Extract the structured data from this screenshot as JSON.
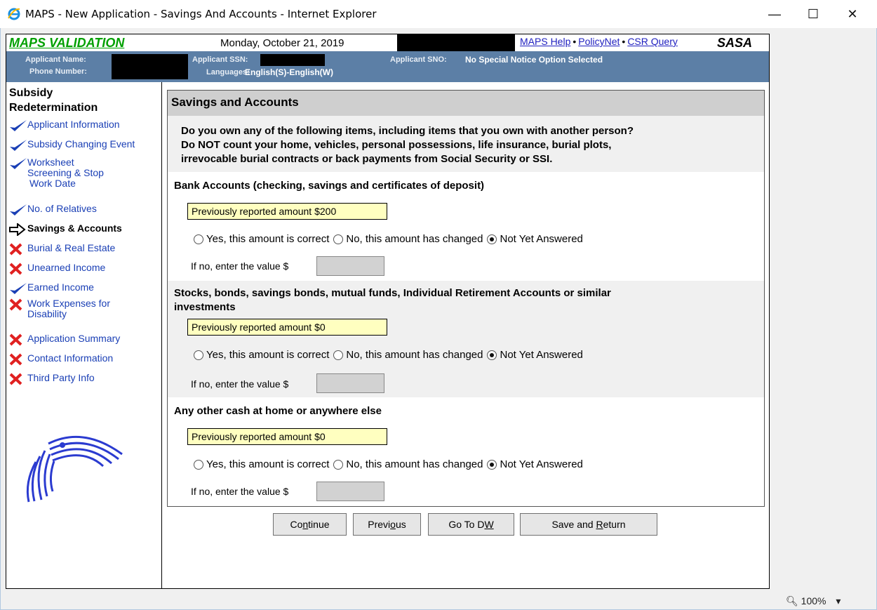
{
  "window": {
    "title": "MAPS - New Application - Savings And Accounts - Internet Explorer",
    "minimize": "—",
    "maximize": "☐",
    "close": "✕"
  },
  "topbar": {
    "maps_validation": "MAPS VALIDATION",
    "date": "Monday, October 21, 2019",
    "links": [
      "MAPS Help",
      "PolicyNet",
      "CSR Query"
    ],
    "separator": "•",
    "sasa": "SASA"
  },
  "infobar": {
    "applicant_name_label": "Applicant Name:",
    "phone_number_label": "Phone Number:",
    "applicant_ssn_label": "Applicant SSN:",
    "languages_label": "Languages:",
    "languages_value": "English(S)-English(W)",
    "applicant_sno_label": "Applicant SNO:",
    "applicant_sno_value": "No Special Notice Option Selected"
  },
  "sidebar": {
    "heading_line1": "Subsidy",
    "heading_line2": "Redetermination",
    "items": [
      {
        "label": "Applicant Information",
        "status": "check"
      },
      {
        "label": "Subsidy Changing Event",
        "status": "check"
      },
      {
        "label_line1": "Worksheet",
        "label_line2": "Screening  & Stop",
        "label_line3": "Work  Date",
        "status": "check"
      },
      {
        "label": "No. of Relatives",
        "status": "check"
      },
      {
        "label": "Savings & Accounts",
        "status": "current"
      },
      {
        "label": "Burial & Real Estate",
        "status": "x"
      },
      {
        "label": "Unearned Income",
        "status": "x"
      },
      {
        "label": "Earned Income",
        "status": "check"
      },
      {
        "label_line1": "Work Expenses for",
        "label_line2": "Disability",
        "status": "x"
      },
      {
        "label": "Application Summary",
        "status": "x"
      },
      {
        "label": "Contact Information",
        "status": "x"
      },
      {
        "label": "Third Party Info",
        "status": "x"
      }
    ]
  },
  "main": {
    "title": "Savings and Accounts",
    "question_line1": "Do you own any of the following items, including items that you own with another person?",
    "question_line2": "Do NOT count your home, vehicles, personal possessions, life insurance, burial plots,",
    "question_line3": "irrevocable burial contracts or back payments from Social Security or SSI.",
    "sections": [
      {
        "title_line1": "Bank Accounts (checking, savings and certificates of deposit)",
        "title_line2": "",
        "previous": "Previously reported amount $200",
        "opt_yes": "Yes, this amount is correct",
        "opt_no": "No, this amount has changed",
        "opt_na": "Not Yet Answered",
        "selected": "Not Yet Answered",
        "ifno_label": "If no, enter the value $",
        "value": ""
      },
      {
        "title_line1": "Stocks, bonds, savings bonds, mutual funds, Individual Retirement Accounts or similar",
        "title_line2": "investments",
        "previous": "Previously reported amount $0",
        "opt_yes": "Yes, this amount is correct",
        "opt_no": "No, this amount has changed",
        "opt_na": "Not Yet Answered",
        "selected": "Not Yet Answered",
        "ifno_label": "If no, enter the value $",
        "value": ""
      },
      {
        "title_line1": "Any other cash at home or anywhere else",
        "title_line2": "",
        "previous": "Previously reported amount $0",
        "opt_yes": "Yes, this amount is correct",
        "opt_no": "No, this amount has changed",
        "opt_na": "Not Yet Answered",
        "selected": "Not Yet Answered",
        "ifno_label": "If no, enter the value $",
        "value": ""
      }
    ]
  },
  "buttons": {
    "continue_pre": "Co",
    "continue_u": "n",
    "continue_post": "tinue",
    "previous_pre": "Previ",
    "previous_u": "o",
    "previous_post": "us",
    "gotodw_pre": "Go To D",
    "gotodw_u": "W",
    "gotodw_post": "",
    "save_pre": "Save and ",
    "save_u": "R",
    "save_post": "eturn"
  },
  "status": {
    "zoom": "100%"
  },
  "colors": {
    "infobar": "#5c7fa6",
    "link": "#1a3fb5",
    "validation_green": "#00a000",
    "prev_amount_bg": "#ffffc0",
    "x_red": "#e02020",
    "check_blue": "#1a3fb5"
  }
}
